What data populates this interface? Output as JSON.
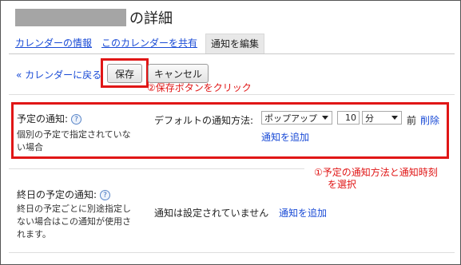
{
  "header": {
    "title_suffix": "の詳細"
  },
  "tabs": [
    {
      "label": "カレンダーの情報"
    },
    {
      "label": "このカレンダーを共有"
    },
    {
      "label": "通知を編集"
    }
  ],
  "toolbar": {
    "back_link": "« カレンダーに戻る",
    "save_label": "保存",
    "cancel_label": "キャンセル"
  },
  "annotations": {
    "save": "②保存ボタンをクリック",
    "method_line1": "①予定の通知方法と通知時刻",
    "method_line2": "を選択"
  },
  "event_notifications": {
    "label": "予定の通知:",
    "help": "?",
    "description_line1": "個別の予定で指定されていな",
    "description_line2": "い場合",
    "default_method_label": "デフォルトの通知方法:",
    "method_value": "ポップアップ",
    "time_value": "10",
    "unit_value": "分",
    "before_text": "前",
    "delete_label": "削除",
    "add_label": "通知を追加"
  },
  "allday_notifications": {
    "label": "終日の予定の通知:",
    "help": "?",
    "description_line1": "終日の予定ごとに別途指定し",
    "description_line2": "ない場合はこの通知が使用さ",
    "description_line3": "れます。",
    "value": "通知は設定されていません",
    "add_label": "通知を追加"
  },
  "colors": {
    "link": "#1a4bd6",
    "annotation": "#e01616",
    "redaction": "#a5a5a5"
  }
}
